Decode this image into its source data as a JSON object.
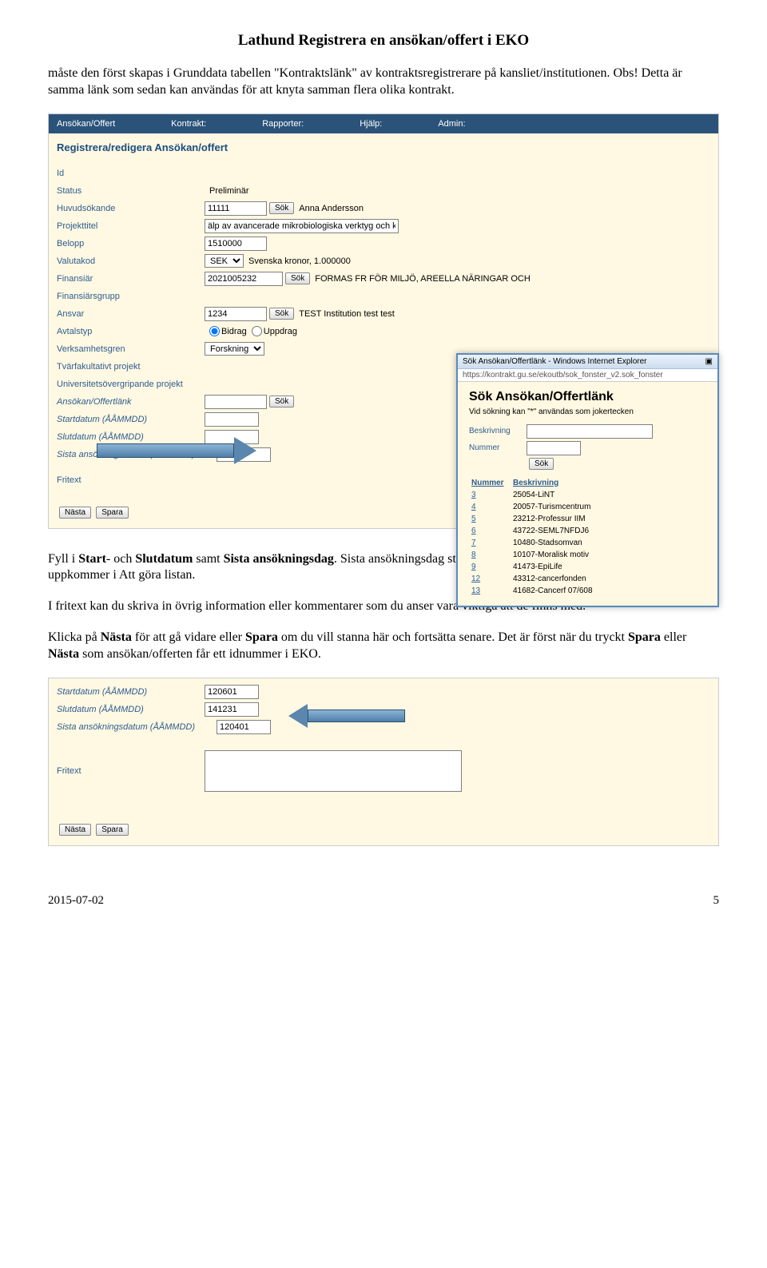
{
  "title": "Lathund Registrera en ansökan/offert i EKO",
  "p1": "måste den först skapas i Grunddata tabellen \"Kontraktslänk\" av kontraktsregistrerare på kansliet/institutionen. Obs! Detta är samma länk som sedan kan användas för att knyta samman flera olika kontrakt.",
  "p2a": "Fyll i ",
  "p2b": "Start",
  "p2c": "- och ",
  "p2d": "Slutdatum",
  "p2e": " samt ",
  "p2f": "Sista ansökningsdag",
  "p2g": ". Sista ansökningsdag styr även vilket datumintervall som ansökan/offerten uppkommer i Att göra listan.",
  "p3": "I fritext kan du skriva in övrig information eller kommentarer som du anser vara viktiga att de finns med.",
  "p4a": "Klicka på ",
  "p4b": "Nästa",
  "p4c": " för att gå vidare eller ",
  "p4d": "Spara",
  "p4e": " om du vill stanna här och fortsätta senare. Det är först när du tryckt ",
  "p4f": "Spara",
  "p4g": " eller ",
  "p4h": "Nästa",
  "p4i": " som ansökan/offerten får ett idnummer i EKO.",
  "nav": {
    "a": "Ansökan/Offert",
    "b": "Kontrakt:",
    "c": "Rapporter:",
    "d": "Hjälp:",
    "e": "Admin:"
  },
  "sect": "Registrera/redigera Ansökan/offert",
  "fields": {
    "id": "Id",
    "status": "Status",
    "status_v": "Preliminär",
    "huvud": "Huvudsökande",
    "huvud_v": "11111",
    "huvud_after": "Anna Andersson",
    "titel": "Projekttitel",
    "titel_v": "älp av avancerade mikrobiologiska verktyg och koncept.",
    "belopp": "Belopp",
    "belopp_v": "1510000",
    "valuta": "Valutakod",
    "valuta_sel": "SEK",
    "valuta_after": "Svenska kronor, 1.000000",
    "fin": "Finansiär",
    "fin_v": "2021005232",
    "fin_after": "FORMAS FR FÖR MILJÖ, AREELLA NÄRINGAR OCH",
    "fingrp": "Finansiärsgrupp",
    "ansvar": "Ansvar",
    "ansvar_v": "1234",
    "ansvar_after": "TEST Institution test test",
    "avtalstyp": "Avtalstyp",
    "bidrag": "Bidrag",
    "uppdrag": "Uppdrag",
    "verk": "Verksamhetsgren",
    "verk_sel": "Forskning",
    "tvar": "Tvärfakultativt projekt",
    "univ": "Universitetsövergripande projekt",
    "link": "Ansökan/Offertlänk",
    "start": "Startdatum (ÅÅMMDD)",
    "slut": "Slutdatum (ÅÅMMDD)",
    "sista": "Sista ansökningsdatum (ÅÅMMDD)",
    "fritext": "Fritext"
  },
  "sok": "Sök",
  "nasta": "Nästa",
  "spara": "Spara",
  "popup": {
    "titlebar": "Sök Ansökan/Offertlänk - Windows Internet Explorer",
    "url": "https://kontrakt.gu.se/ekoutb/sok_fonster_v2.sok_fonster",
    "head": "Sök Ansökan/Offertlänk",
    "sub": "Vid sökning kan \"*\" användas som jokertecken",
    "beskr": "Beskrivning",
    "nummer": "Nummer",
    "th1": "Nummer",
    "th2": "Beskrivning",
    "rows": [
      [
        "3",
        "25054-LiNT"
      ],
      [
        "4",
        "20057-Turismcentrum"
      ],
      [
        "5",
        "23212-Professur IIM"
      ],
      [
        "6",
        "43722-SEML7NFDJ6"
      ],
      [
        "7",
        "10480-Stadsomvan"
      ],
      [
        "8",
        "10107-Moralisk motiv"
      ],
      [
        "9",
        "41473-EpiLife"
      ],
      [
        "12",
        "43312-cancerfonden"
      ],
      [
        "13",
        "41682-Cancerf 07/608"
      ]
    ]
  },
  "ss2": {
    "start_v": "120601",
    "slut_v": "141231",
    "sista_v": "120401"
  },
  "footer": {
    "date": "2015-07-02",
    "page": "5"
  }
}
